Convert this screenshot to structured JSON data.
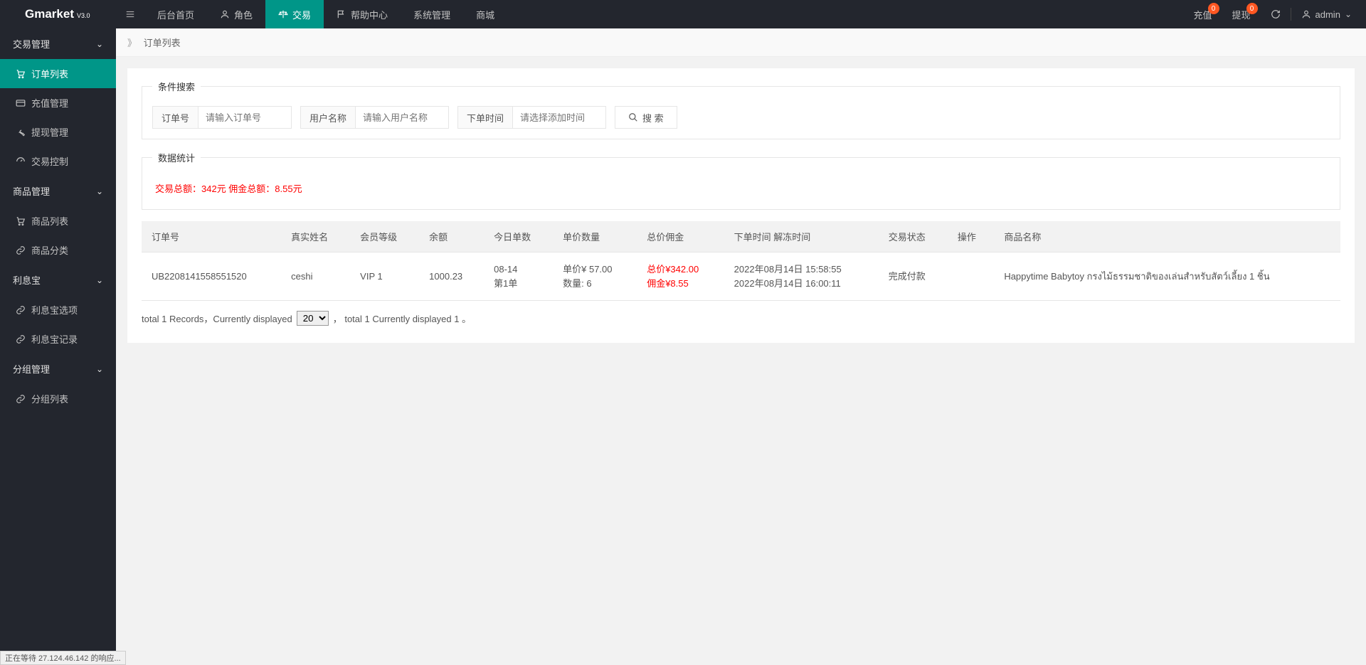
{
  "brand": {
    "name": "Gmarket",
    "version": "V3.0"
  },
  "topnav": {
    "items": [
      {
        "label": "后台首页",
        "icon": ""
      },
      {
        "label": "角色",
        "icon": "user"
      },
      {
        "label": "交易",
        "icon": "scale",
        "active": true
      },
      {
        "label": "帮助中心",
        "icon": "flag"
      },
      {
        "label": "系统管理",
        "icon": ""
      },
      {
        "label": "商城",
        "icon": ""
      }
    ]
  },
  "header_right": {
    "recharge": {
      "label": "充值",
      "badge": "0"
    },
    "withdraw": {
      "label": "提现",
      "badge": "0"
    },
    "user": "admin"
  },
  "sidebar": {
    "groups": [
      {
        "label": "交易管理",
        "items": [
          {
            "label": "订单列表",
            "icon": "cart",
            "active": true
          },
          {
            "label": "充值管理",
            "icon": "card"
          },
          {
            "label": "提现管理",
            "icon": "wrench"
          },
          {
            "label": "交易控制",
            "icon": "gauge"
          }
        ]
      },
      {
        "label": "商品管理",
        "items": [
          {
            "label": "商品列表",
            "icon": "cart"
          },
          {
            "label": "商品分类",
            "icon": "link"
          }
        ]
      },
      {
        "label": "利息宝",
        "items": [
          {
            "label": "利息宝选项",
            "icon": "link"
          },
          {
            "label": "利息宝记录",
            "icon": "link"
          }
        ]
      },
      {
        "label": "分组管理",
        "items": [
          {
            "label": "分组列表",
            "icon": "link"
          }
        ]
      }
    ]
  },
  "breadcrumb": {
    "title": "订单列表"
  },
  "search": {
    "legend": "条件搜索",
    "order_label": "订单号",
    "order_ph": "请输入订单号",
    "user_label": "用户名称",
    "user_ph": "请输入用户名称",
    "time_label": "下单时间",
    "time_ph": "请选择添加时间",
    "btn": "搜 索"
  },
  "stats": {
    "legend": "数据统计",
    "text": "交易总额：342元   佣金总额：8.55元"
  },
  "table": {
    "headers": [
      "订单号",
      "真实姓名",
      "会员等级",
      "余额",
      "今日单数",
      "单价数量",
      "总价佣金",
      "下单时间 解冻时间",
      "交易状态",
      "操作",
      "商品名称"
    ],
    "rows": [
      {
        "order_no": "UB2208141558551520",
        "real_name": "ceshi",
        "level": "VIP 1",
        "balance": "1000.23",
        "today_l1": "08-14",
        "today_l2": "第1单",
        "price_l1": "单价¥  57.00",
        "price_l2": "数量:  6",
        "total_l1": "总价¥342.00",
        "total_l2": "佣金¥8.55",
        "time_l1": "2022年08月14日 15:58:55",
        "time_l2": "2022年08月14日 16:00:11",
        "status": "完成付款",
        "op": "",
        "product": "Happytime Babytoy กรงไม้ธรรมชาติของเล่นสำหรับสัตว์เลี้ยง 1 ชิ้น"
      }
    ]
  },
  "pager": {
    "p1": "total 1 Records，Currently displayed",
    "select": "20",
    "p2": "， total 1 Currently displayed 1 。"
  },
  "status_bar": "正在等待 27.124.46.142 的响应..."
}
